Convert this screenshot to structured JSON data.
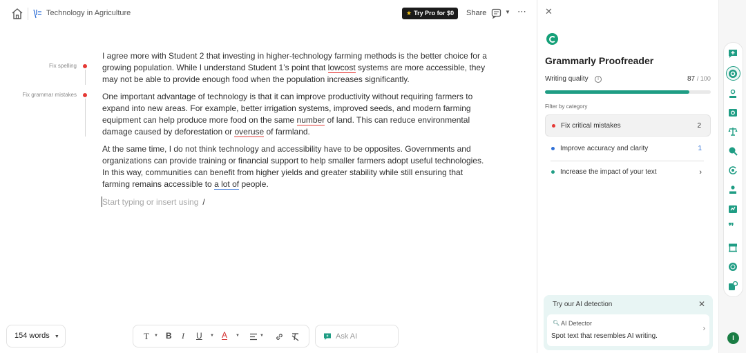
{
  "topbar": {
    "doc_title": "Technology in Agriculture",
    "try_pro_label": "Try Pro for $0",
    "share_label": "Share"
  },
  "editor": {
    "side_notes": [
      {
        "label": "Fix spelling",
        "color": "#e53935"
      },
      {
        "label": "Fix grammar mistakes",
        "color": "#e53935"
      }
    ],
    "para1": {
      "a": "I agree more with Student 2 that investing in higher-technology farming methods is the better choice for a growing population. While I understand Student 1’s point that ",
      "flag": "lowcost",
      "b": " systems are more accessible, they may not be able to provide enough food when the population increases significantly."
    },
    "para2": {
      "a": "One important advantage of technology is that it can improve productivity without requiring farmers to expand into new areas. For example, better irrigation systems, improved seeds, and modern farming equipment can help produce more food on the same ",
      "flag1": "number",
      "b": " of land. This can reduce environmental damage caused by deforestation or ",
      "flag2": "overuse",
      "c": " of farmland."
    },
    "para3": {
      "a": "At the same time, I do not think technology and accessibility have to be opposites. Governments and organizations can provide training or financial support to help smaller farmers adopt useful technologies. In this way, communities can benefit from higher yields and greater stability while still ensuring that farming remains accessible to ",
      "flag": "a lot of",
      "b": " people."
    },
    "placeholder": "Start typing or insert using",
    "slash": "/"
  },
  "bottombar": {
    "word_count": "154 words",
    "ask_ai_placeholder": "Ask AI"
  },
  "panel": {
    "title": "Grammarly Proofreader",
    "writing_quality_label": "Writing quality",
    "score": "87",
    "score_max": "/ 100",
    "score_fraction": 0.87,
    "filter_label": "Filter by category",
    "categories": [
      {
        "label": "Fix critical mistakes",
        "count": "2",
        "color": "#e53935"
      },
      {
        "label": "Improve accuracy and clarity",
        "count": "1",
        "color": "#2f6fd6"
      },
      {
        "label": "Increase the impact of your text",
        "count": "",
        "color": "#1f9d84"
      }
    ],
    "ai_card": {
      "header": "Try our AI detection",
      "detector_label": "AI Detector",
      "description": "Spot text that resembles AI writing."
    }
  },
  "rail": {
    "user_initial": "I",
    "accent": "#1f9d84"
  }
}
